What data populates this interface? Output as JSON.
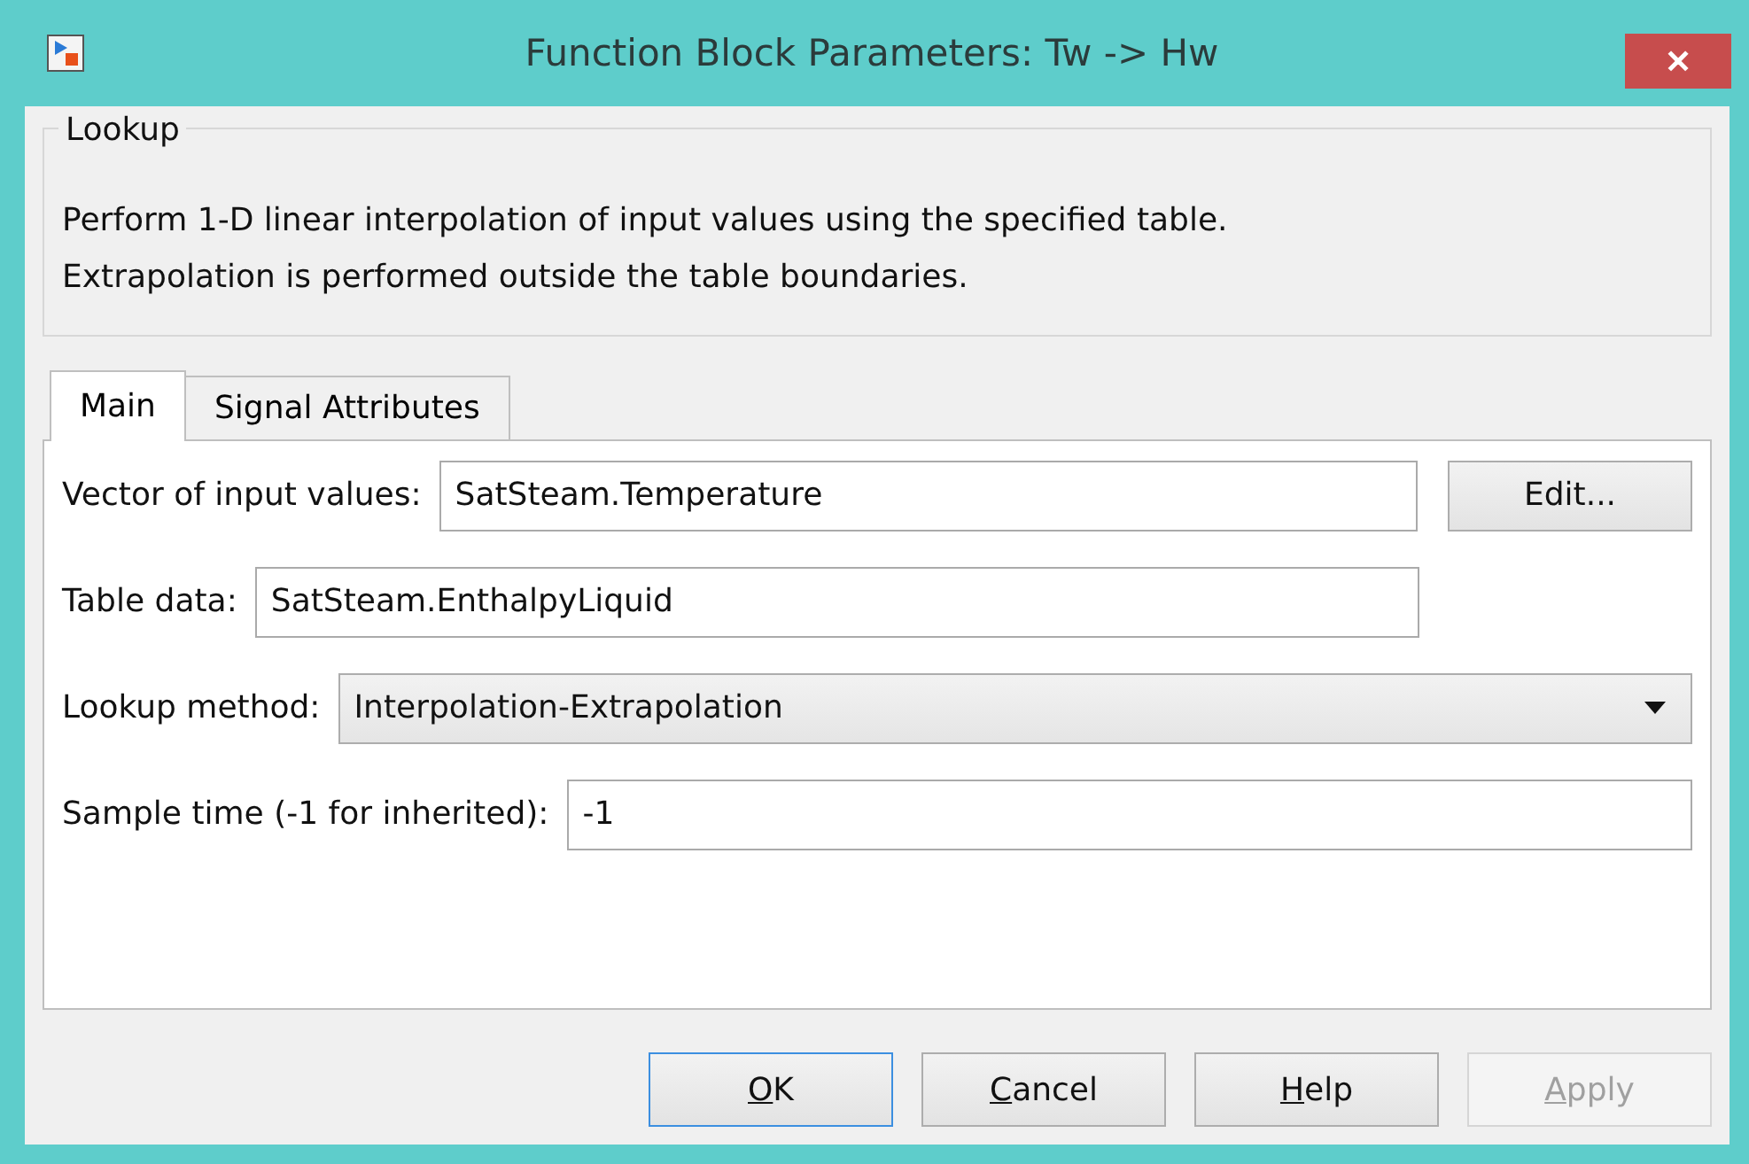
{
  "window": {
    "title": "Function Block Parameters: Tw -> Hw",
    "close": "✕"
  },
  "group": {
    "title": "Lookup",
    "description": "Perform 1-D linear interpolation of input values using the specified table.\nExtrapolation is performed outside the table boundaries."
  },
  "tabs": [
    {
      "label": "Main",
      "selected": true
    },
    {
      "label": "Signal Attributes",
      "selected": false
    }
  ],
  "parameters": [
    {
      "kind": "edit",
      "label": "Vector of input values:",
      "value": "SatSteam.Temperature",
      "button": "Edit..."
    },
    {
      "kind": "short",
      "label": "Table data:",
      "value": "SatSteam.EnthalpyLiquid"
    },
    {
      "kind": "dropdown",
      "label": "Lookup method:",
      "value": "Interpolation-Extrapolation"
    },
    {
      "kind": "text",
      "label": "Sample time (-1 for inherited):",
      "value": "-1"
    }
  ],
  "buttons": [
    {
      "label": "OK",
      "mnemonic": true,
      "focused": true,
      "disabled": false
    },
    {
      "label": "Cancel",
      "mnemonic": true,
      "focused": false,
      "disabled": false
    },
    {
      "label": "Help",
      "mnemonic": true,
      "focused": false,
      "disabled": false
    },
    {
      "label": "Apply",
      "mnemonic": true,
      "focused": false,
      "disabled": true
    }
  ]
}
